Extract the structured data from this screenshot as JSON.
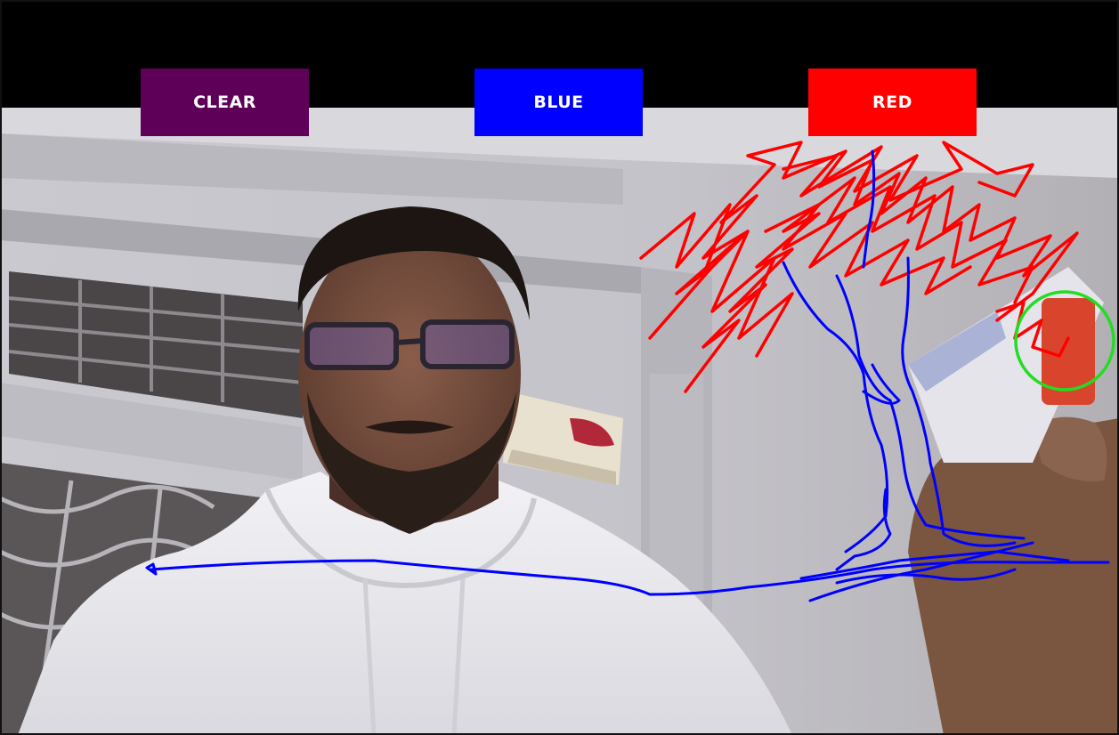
{
  "toolbar": {
    "clear_label": "CLEAR",
    "blue_label": "BLUE",
    "red_label": "RED"
  },
  "colors": {
    "toolbar_bg": "#000000",
    "clear": "#5e0058",
    "blue": "#0000ff",
    "red": "#ff0000",
    "cursor_ring": "#22dd22"
  },
  "icons": {
    "cursor": "green-ring-cursor"
  }
}
